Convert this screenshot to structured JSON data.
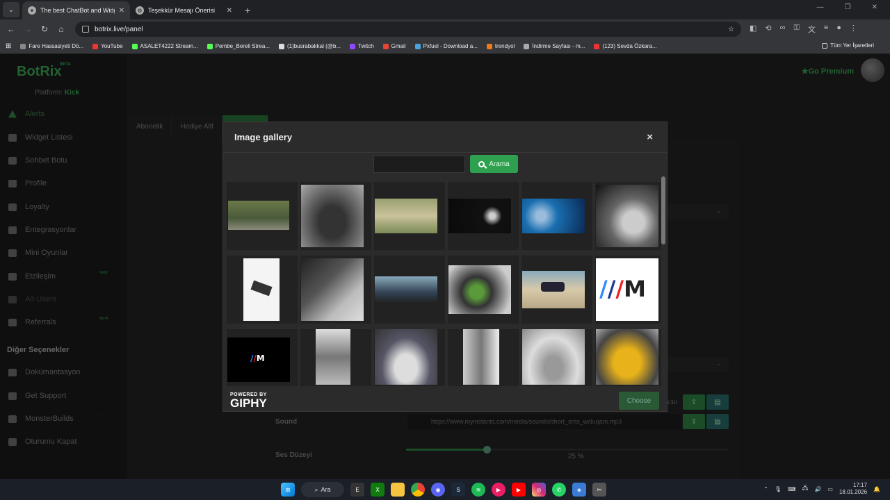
{
  "browser": {
    "tabs": [
      {
        "title": "The best ChatBot and Widgets",
        "active": true
      },
      {
        "title": "Teşekkür Mesajı Önerisi",
        "active": false
      }
    ],
    "url": "botrix.live/panel",
    "bookmarks": [
      "Fare Hassasiyeti Dö...",
      "YouTube",
      "ASALET4222 Stream...",
      "Pembe_Bereli Strea...",
      "(1)busrabakkal (@b...",
      "Twitch",
      "Gmail",
      "Pxfuel - Download a...",
      "trendyol",
      "İndirme Sayfası - m...",
      "(123) Sevda Özkara..."
    ],
    "all_bookmarks": "Tüm Yer İşaretleri"
  },
  "app": {
    "logo": "BotRix",
    "beta": "BETA",
    "platform_label": "Platform:",
    "platform_value": "Kick",
    "go_premium": "Go Premium",
    "nav": [
      {
        "label": "Alerts",
        "icon": "alert-icon",
        "active": true
      },
      {
        "label": "Widget Listesi",
        "icon": "list-icon"
      },
      {
        "label": "Sohbet Botu",
        "icon": "bot-icon"
      },
      {
        "label": "Profile",
        "icon": "profile-icon"
      },
      {
        "label": "Loyalty",
        "icon": "trophy-icon"
      },
      {
        "label": "Entegrasyonlar",
        "icon": "integration-icon"
      },
      {
        "label": "Mini Oyunlar",
        "icon": "game-icon"
      },
      {
        "label": "Etzileşim",
        "icon": "music-icon",
        "badge": "YENİ"
      },
      {
        "label": "Alt-Users",
        "icon": "users-icon",
        "disabled": true
      },
      {
        "label": "Referrals",
        "icon": "referral-icon",
        "badge": "BETA"
      }
    ],
    "section_label": "Diğer Seçenekler",
    "other_nav": [
      {
        "label": "Dokümantasyon",
        "icon": "doc-icon"
      },
      {
        "label": "Get Support",
        "icon": "support-icon"
      },
      {
        "label": "MonsterBuilds",
        "icon": "monitor-icon"
      },
      {
        "label": "Oturumu Kapat",
        "icon": "logout-icon"
      }
    ],
    "tabs": [
      "Abonelik",
      "Hediye Altl"
    ],
    "sound_label": "Sound",
    "sound_url": "https://www.myinstants.com/media/sounds/short_sms_wcluqam.mp3",
    "volume_label": "Ses Düzeyi",
    "volume_value": 0.25,
    "volume_text": "25 %",
    "partial_text": "c1n"
  },
  "modal": {
    "title": "Image gallery",
    "close": "×",
    "search_placeholder": "",
    "search_button": "Arama",
    "powered_by": "POWERED BY",
    "giphy": "GIPHY",
    "choose": "Choose"
  },
  "taskbar": {
    "search": "Ara",
    "time": "17:17",
    "date": "18.01.2026"
  }
}
